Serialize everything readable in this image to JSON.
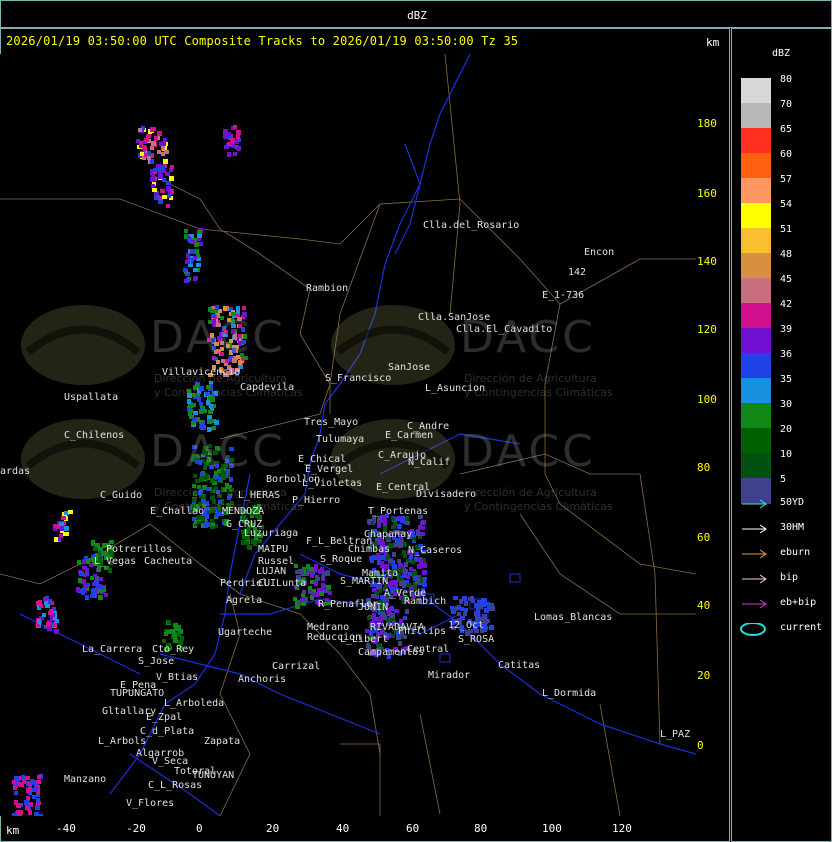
{
  "window": {
    "title": "dBZ"
  },
  "header": {
    "line": "2026/01/19 03:50:00 UTC Composite Tracks to 2026/01/19 03:50:00 Tz 35",
    "km_top": "km",
    "km_bottom": "km"
  },
  "axes": {
    "y_ticks": [
      "180",
      "160",
      "140",
      "120",
      "100",
      "80",
      "60",
      "40",
      "20",
      "0"
    ],
    "x_ticks": [
      "-40",
      "-20",
      "0",
      "20",
      "40",
      "60",
      "80",
      "100",
      "120"
    ]
  },
  "legend": {
    "title": "dBZ",
    "scale": [
      {
        "label": "80",
        "color": "#d8d8d8"
      },
      {
        "label": "70",
        "color": "#b8b8b8"
      },
      {
        "label": "65",
        "color": "#ff3020"
      },
      {
        "label": "60",
        "color": "#ff6010"
      },
      {
        "label": "57",
        "color": "#ff9860"
      },
      {
        "label": "54",
        "color": "#ffff00"
      },
      {
        "label": "51",
        "color": "#f8c030"
      },
      {
        "label": "48",
        "color": "#d89040"
      },
      {
        "label": "45",
        "color": "#c87080"
      },
      {
        "label": "42",
        "color": "#d0108c"
      },
      {
        "label": "39",
        "color": "#7010d0"
      },
      {
        "label": "36",
        "color": "#2040e8"
      },
      {
        "label": "35",
        "color": "#1890e0"
      },
      {
        "label": "30",
        "color": "#108818"
      },
      {
        "label": "20",
        "color": "#006000"
      },
      {
        "label": "10",
        "color": "#005010"
      },
      {
        "label": "5",
        "color": "#40408c"
      }
    ],
    "tracks": [
      {
        "label": "50YD",
        "color": "#40e0e0",
        "icon": "arrow"
      },
      {
        "label": "30HM",
        "color": "#ffffff",
        "icon": "arrow"
      },
      {
        "label": "eburn",
        "color": "#e0a040",
        "icon": "arrow"
      },
      {
        "label": "bip",
        "color": "#ffc8c8",
        "icon": "arrow"
      },
      {
        "label": "eb+bip",
        "color": "#d040d0",
        "icon": "arrow"
      },
      {
        "label": "current",
        "color": "#20e0e0",
        "icon": "ellipse"
      }
    ]
  },
  "map": {
    "watermark": {
      "brand": "DACC",
      "line1": "Dirección de Agricultura",
      "line2": "y Contingencias Climáticas"
    },
    "places": [
      "Clla.del_Rosario",
      "Encon",
      "142",
      "E_1-736",
      "Rambion",
      "Clla.SanJose",
      "Clla.El_Cavadito",
      "Villavicencio",
      "Capdevila",
      "S_Francisco",
      "SanJose",
      "L_Asuncion",
      "Uspallata",
      "Tres_Mayo",
      "C_Andre",
      "C_Chilenos",
      "Tulumaya",
      "E_Carmen",
      "E_Chical",
      "C_Araujo",
      "N_Calif",
      "ardas",
      "E_Vergel",
      "Borbollon",
      "L_Violetas",
      "E_Central",
      "Divisadero",
      "C_Guido",
      "L_HERAS",
      "P_Hierro",
      "E_Challao",
      "MENDOZA",
      "T_Portenas",
      "G_CRUZ",
      "Luzuriaga",
      "Chapanay",
      "F_L_Beltran",
      "Potrerillos",
      "MAIPU",
      "Chimbas",
      "N_Caseros",
      "Cacheuta",
      "L_Vegas",
      "Russel",
      "S_Roque",
      "LUJAN",
      "Mamita",
      "CUILunta",
      "Perdriel",
      "S_MARTIN",
      "A_Verde",
      "Agrela",
      "Rambich",
      "R_Penaflor",
      "JUNIN",
      "Medrano",
      "RIVADAVIA",
      "12_Oct",
      "Lomas_Blancas",
      "Ugarteche",
      "Reduccion",
      "Phillips",
      "L_Libert",
      "S_ROSA",
      "La_Carrera",
      "Cto_Rey",
      "S_Jose",
      "Campamentos",
      "Central",
      "Carrizal",
      "Catitas",
      "V_Btias",
      "Anchoris",
      "Mirador",
      "E_Pena",
      "TUPUNGATO",
      "L_Dormida",
      "L_Arboleda",
      "Gltallary",
      "E_Zpal",
      "C_d_Plata",
      "L_Arbols",
      "Zapata",
      "L_PAZ",
      "Algarrob",
      "V_Seca",
      "Totoral",
      "TUNUYAN",
      "Manzano",
      "C_L_Rosas",
      "V_Flores"
    ]
  }
}
